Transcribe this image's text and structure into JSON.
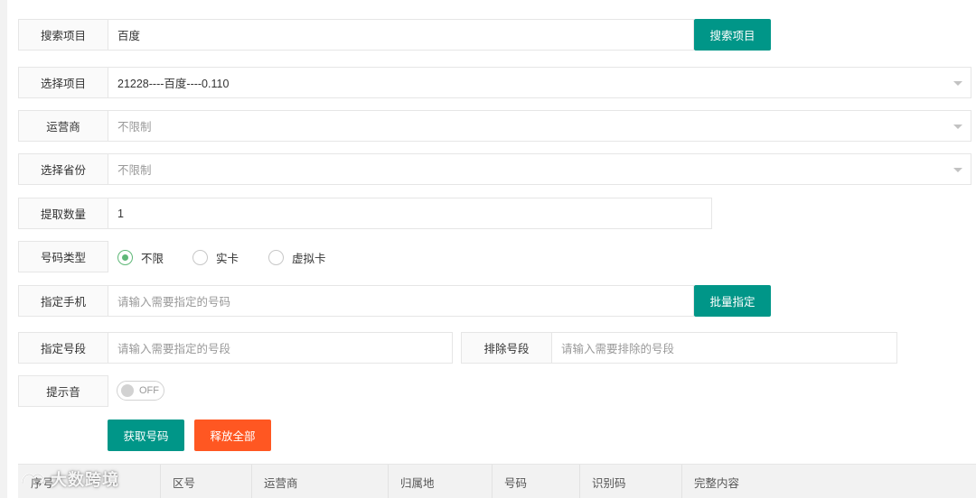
{
  "search_project": {
    "label": "搜索项目",
    "value": "百度",
    "button": "搜索项目"
  },
  "select_project": {
    "label": "选择项目",
    "value": "21228----百度----0.110"
  },
  "carrier": {
    "label": "运营商",
    "value": "不限制"
  },
  "province": {
    "label": "选择省份",
    "value": "不限制"
  },
  "quantity": {
    "label": "提取数量",
    "value": "1"
  },
  "number_type": {
    "label": "号码类型",
    "options": [
      {
        "label": "不限",
        "selected": true
      },
      {
        "label": "实卡",
        "selected": false
      },
      {
        "label": "虚拟卡",
        "selected": false
      }
    ]
  },
  "assign_phone": {
    "label": "指定手机",
    "placeholder": "请输入需要指定的号码",
    "button": "批量指定"
  },
  "assign_segment": {
    "label": "指定号段",
    "placeholder": "请输入需要指定的号段"
  },
  "exclude_segment": {
    "label": "排除号段",
    "placeholder": "请输入需要排除的号段"
  },
  "sound": {
    "label": "提示音",
    "state": "OFF"
  },
  "actions": {
    "get_number": "获取号码",
    "release_all": "释放全部"
  },
  "table": {
    "columns": [
      "序号",
      "区号",
      "运营商",
      "归属地",
      "号码",
      "识别码",
      "完整内容"
    ]
  },
  "watermark": "大数跨境",
  "colors": {
    "primary": "#009688",
    "danger": "#ff5722",
    "radio_checked": "#5fb878",
    "border": "#e6e6e6",
    "label_bg": "#fafafa"
  }
}
